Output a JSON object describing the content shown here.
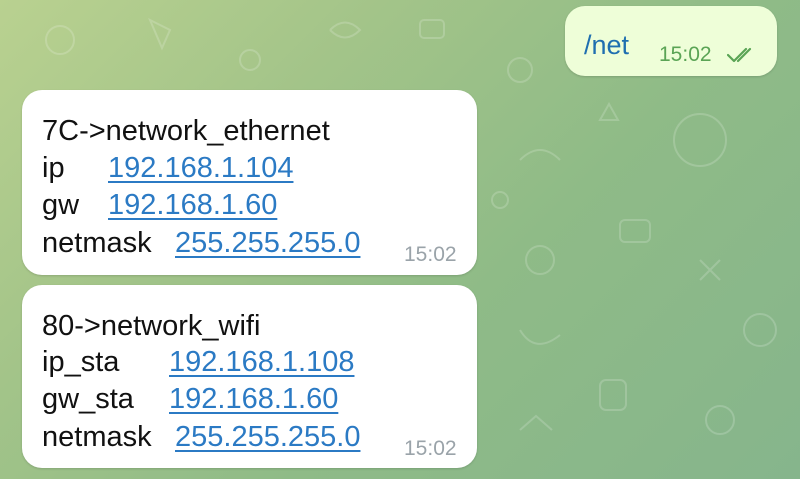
{
  "outgoing": {
    "text": "/net",
    "time": "15:02",
    "status_icon": "double-check-icon"
  },
  "messages": [
    {
      "header": "7C->network_ethernet",
      "rows": [
        {
          "label": "ip",
          "value": "192.168.1.104"
        },
        {
          "label": "gw",
          "value": "192.168.1.60"
        },
        {
          "label": "netmask",
          "value": "255.255.255.0"
        }
      ],
      "time": "15:02"
    },
    {
      "header": "80->network_wifi",
      "rows": [
        {
          "label": "ip_sta",
          "value": "192.168.1.108"
        },
        {
          "label": "gw_sta",
          "value": "192.168.1.60"
        },
        {
          "label": "netmask",
          "value": "255.255.255.0"
        }
      ],
      "time": "15:02"
    }
  ],
  "colors": {
    "outgoing_bubble": "#eefed8",
    "incoming_bubble": "#ffffff",
    "link": "#2b7ac4",
    "outgoing_time": "#5aa455",
    "incoming_time": "#9aa3a9"
  }
}
